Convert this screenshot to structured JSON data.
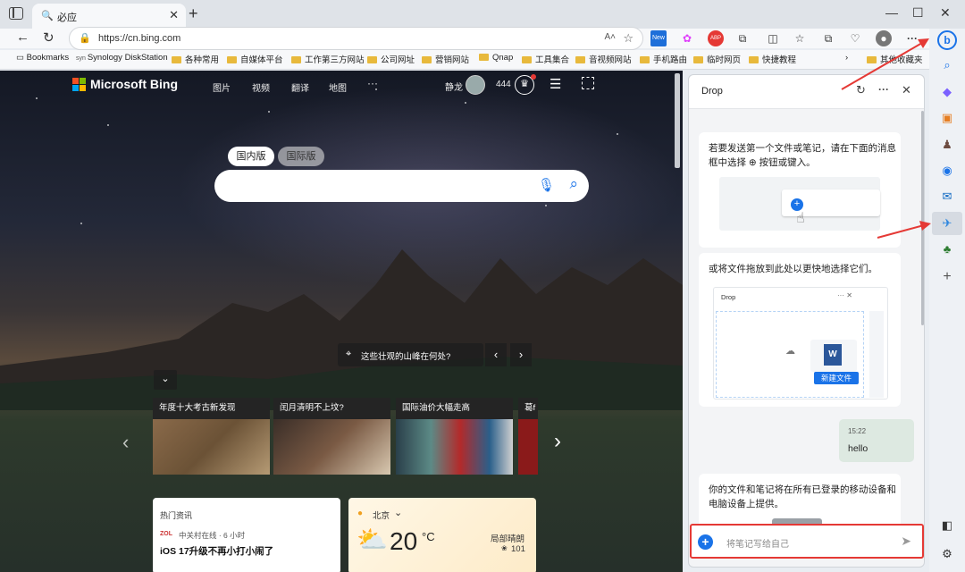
{
  "tab": {
    "title": "必应"
  },
  "address": {
    "url": "https://cn.bing.com",
    "reader_label": "A˄"
  },
  "bookmarks": [
    {
      "label": "Bookmarks"
    },
    {
      "label": "Synology DiskStation"
    },
    {
      "label": "各种常用"
    },
    {
      "label": "自媒体平台"
    },
    {
      "label": "工作第三方网站"
    },
    {
      "label": "公司网址"
    },
    {
      "label": "营销网站"
    },
    {
      "label": "Qnap"
    },
    {
      "label": "工具集合"
    },
    {
      "label": "音视频网站"
    },
    {
      "label": "手机路由"
    },
    {
      "label": "临时网页"
    },
    {
      "label": "快捷教程"
    },
    {
      "label": "其他收藏夹"
    }
  ],
  "extensions": {
    "new_badge": "New",
    "abp_badge": "ABP"
  },
  "bing": {
    "brand": "Microsoft Bing",
    "nav": [
      "图片",
      "视频",
      "翻译",
      "地图"
    ],
    "more": "···",
    "user_name": "静龙",
    "points": "444",
    "tabs": [
      "国内版",
      "国际版"
    ],
    "location_question": "这些壮观的山峰在何处?",
    "tiles": [
      "年度十大考古新发现",
      "闰月清明不上坟?",
      "国际油价大幅走高",
      "葛f"
    ],
    "news": {
      "title": "热门资讯",
      "source": "中关村在线 · 6 小时",
      "headline": "iOS 17升级不再小打小闹了"
    },
    "weather": {
      "city": "北京",
      "temp": "20",
      "unit": "°C",
      "cond": "局部晴朗",
      "aqi": "101"
    }
  },
  "drop": {
    "title": "Drop",
    "intro": "若要发送第一个文件或笔记，请在下面的消息框中选择 ⊕ 按钮或键入。",
    "drag_hint": "或将文件拖放到此处以更快地选择它们。",
    "mini_title": "Drop",
    "new_file": "新建文件",
    "note_time": "15:22",
    "note_text": "hello",
    "sync_text": "你的文件和笔记将在所有已登录的移动设备和电脑设备上提供。",
    "composer_placeholder": "将笔记写给自己"
  },
  "colors": {
    "accent": "#1a73e8",
    "highlight": "#e53935"
  }
}
